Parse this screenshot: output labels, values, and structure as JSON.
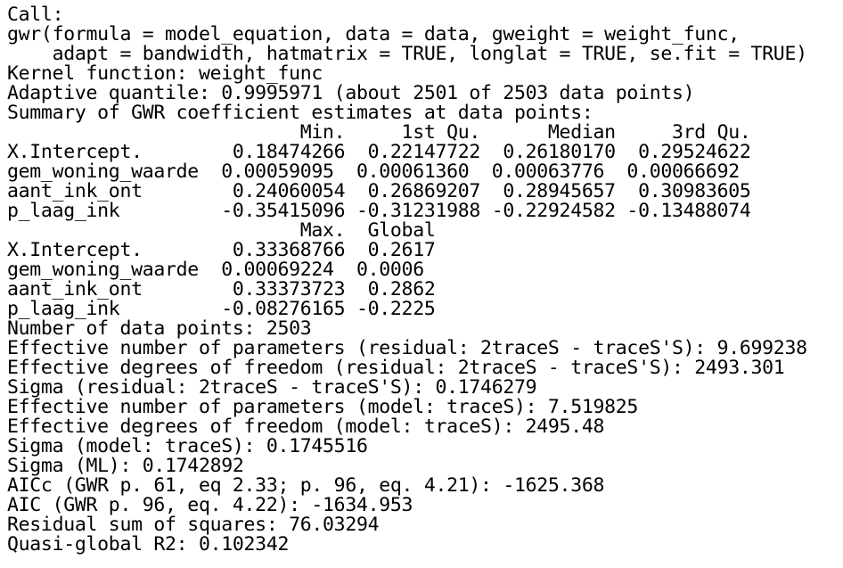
{
  "console": {
    "lines": [
      "Call:",
      "gwr(formula = model_equation, data = data, gweight = weight_func,",
      "    adapt = bandwidth, hatmatrix = TRUE, longlat = TRUE, se.fit = TRUE)",
      "Kernel function: weight_func",
      "Adaptive quantile: 0.9995971 (about 2501 of 2503 data points)",
      "Summary of GWR coefficient estimates at data points:",
      "                          Min.     1st Qu.      Median     3rd Qu.",
      "X.Intercept.        0.18474266  0.22147722  0.26180170  0.29524622",
      "gem_woning_waarde  0.00059095  0.00061360  0.00063776  0.00066692",
      "aant_ink_ont        0.24060054  0.26869207  0.28945657  0.30983605",
      "p_laag_ink         -0.35415096 -0.31231988 -0.22924582 -0.13488074",
      "                          Max.  Global",
      "X.Intercept.        0.33368766  0.2617",
      "gem_woning_waarde  0.00069224  0.0006",
      "aant_ink_ont        0.33373723  0.2862",
      "p_laag_ink         -0.08276165 -0.2225",
      "Number of data points: 2503",
      "Effective number of parameters (residual: 2traceS - traceS'S): 9.699238",
      "Effective degrees of freedom (residual: 2traceS - traceS'S): 2493.301",
      "Sigma (residual: 2traceS - traceS'S): 0.1746279",
      "Effective number of parameters (model: traceS): 7.519825",
      "Effective degrees of freedom (model: traceS): 2495.48",
      "Sigma (model: traceS): 0.1745516",
      "Sigma (ML): 0.1742892",
      "AICc (GWR p. 61, eq 2.33; p. 96, eq. 4.21): -1625.368",
      "AIC (GWR p. 96, eq. 4.22): -1634.953",
      "Residual sum of squares: 76.03294",
      "Quasi-global R2: 0.102342"
    ]
  }
}
